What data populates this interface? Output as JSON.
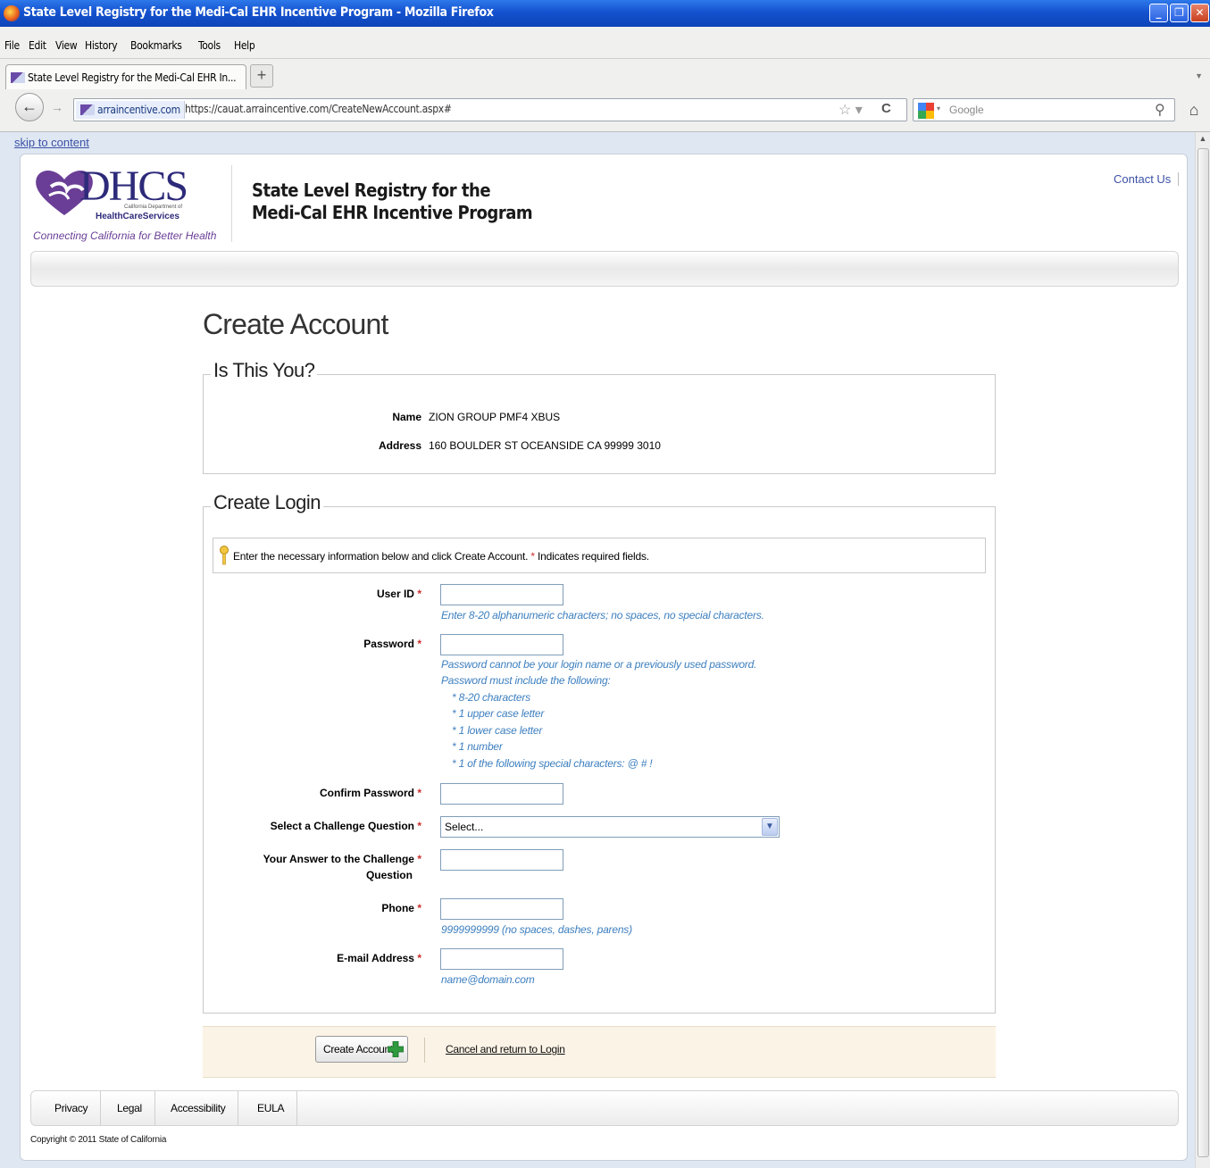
{
  "window": {
    "title": "State Level Registry for the Medi-Cal EHR Incentive Program - Mozilla Firefox"
  },
  "menu": [
    "File",
    "Edit",
    "View",
    "History",
    "Bookmarks",
    "Tools",
    "Help"
  ],
  "tab": {
    "label": "State Level Registry for the Medi-Cal EHR In...",
    "new_tab": "+"
  },
  "nav": {
    "site_identity": "arraincentive.com",
    "url": "https://cauat.arraincentive.com/CreateNewAccount.aspx#",
    "search_placeholder": "Google"
  },
  "page": {
    "skip_link": "skip to content",
    "logo_text": "DHCS",
    "logo_sub1": "California Department of",
    "logo_sub2": "HealthCareServices",
    "tagline": "Connecting California for Better Health",
    "app_title_line1": "State Level Registry for the",
    "app_title_line2": "Medi-Cal EHR Incentive Program",
    "contact": "Contact Us",
    "heading": "Create Account",
    "is_you": {
      "legend": "Is This You?",
      "name_label": "Name",
      "name_value": "ZION GROUP PMF4 XBUS",
      "address_label": "Address",
      "address_value": "160 BOULDER ST OCEANSIDE CA 99999 3010"
    },
    "login": {
      "legend": "Create Login",
      "info_prefix": "Enter the necessary information below and click Create Account.",
      "info_star": "*",
      "info_suffix": "Indicates required fields.",
      "required_mark": "*",
      "user_id_label": "User ID",
      "user_id_hint": "Enter 8-20 alphanumeric characters; no spaces, no special characters.",
      "password_label": "Password",
      "password_hints": [
        "Password cannot be your login name or a previously used password.",
        "Password must include the following:",
        "*  8-20 characters",
        "*  1 upper case letter",
        "*  1 lower case letter",
        "*  1 number",
        "*  1 of the following special characters: @ # !"
      ],
      "confirm_label": "Confirm Password",
      "challenge_label": "Select a Challenge Question",
      "challenge_selected": "Select...",
      "answer_label_1": "Your Answer to the Challenge",
      "answer_label_2": "Question",
      "phone_label": "Phone",
      "phone_hint": "9999999999 (no spaces, dashes, parens)",
      "email_label": "E-mail Address",
      "email_hint": "name@domain.com"
    },
    "actions": {
      "create": "Create Account",
      "cancel": "Cancel and return to Login"
    },
    "footer": [
      "Privacy",
      "Legal",
      "Accessibility",
      "EULA"
    ],
    "copyright": "Copyright © 2011 State of California"
  },
  "colors": {
    "link": "#3b50a6",
    "hint": "#3d7fbf",
    "required": "#cc2e2e",
    "action_bg": "#fbf3e6",
    "titlebar": "#1552cf"
  }
}
